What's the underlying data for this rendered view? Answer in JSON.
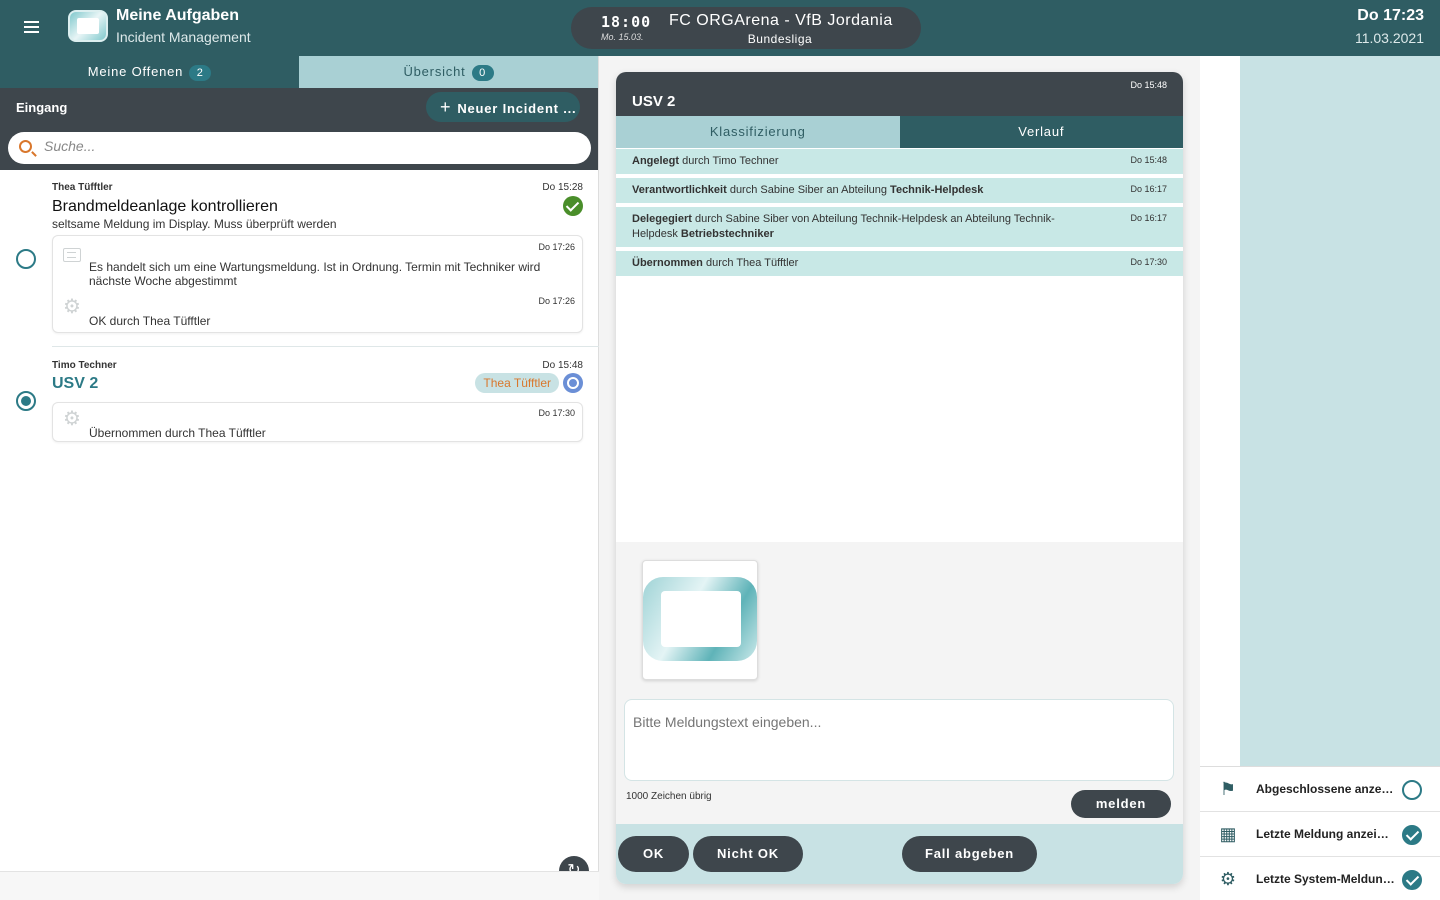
{
  "header": {
    "app_title": "Meine Aufgaben",
    "app_subtitle": "Incident Management",
    "match_time": "18:00",
    "match_date": "Mo. 15.03.",
    "match_teams": "FC ORGArena - VfB Jordania",
    "match_league": "Bundesliga",
    "clock_day": "Do 17:23",
    "clock_date": "11.03.2021"
  },
  "tabs": [
    {
      "label": "Meine Offenen",
      "count": "2"
    },
    {
      "label": "Übersicht",
      "count": "0"
    }
  ],
  "inbox": {
    "label": "Eingang",
    "new_button": "Neuer Incident ...",
    "search_placeholder": "Suche..."
  },
  "incidents": [
    {
      "author": "Thea Tüfftler",
      "time": "Do 15:28",
      "title": "Brandmeldeanlage kontrollieren",
      "description": "seltsame Meldung im Display. Muss überprüft werden",
      "entries": [
        {
          "icon": "message-icon",
          "time": "Do 17:26",
          "text": "Es handelt sich um eine Wartungsmeldung. Ist in Ordnung. Termin mit Techniker wird nächste Woche abgestimmt"
        },
        {
          "icon": "gear-icon",
          "time": "Do 17:26",
          "text": "OK durch Thea Tüfftler"
        }
      ]
    },
    {
      "author": "Timo Techner",
      "time": "Do 15:48",
      "title": "USV 2",
      "assignee": "Thea Tüfftler",
      "entries": [
        {
          "icon": "gear-icon",
          "time": "Do 17:30",
          "text": "Übernommen durch Thea Tüfftler"
        }
      ]
    }
  ],
  "detail": {
    "title": "USV 2",
    "time": "Do 15:48",
    "tabs": [
      "Klassifizierung",
      "Verlauf"
    ],
    "history": [
      {
        "action": "Angelegt",
        "rest": " durch Timo Techner",
        "time": "Do 15:48"
      },
      {
        "action": "Verantwortlichkeit",
        "rest": " durch Sabine Siber an Abteilung ",
        "target": "Technik-Helpdesk",
        "time": "Do 16:17"
      },
      {
        "action": "Delegegiert",
        "rest": " durch Sabine Siber von Abteilung Technik-Helpdesk an Abteilung Technik-Helpdesk ",
        "target": "Betriebstechniker",
        "time": "Do 16:17"
      },
      {
        "action": "Übernommen",
        "rest": " durch Thea Tüfftler",
        "time": "Do 17:30"
      }
    ],
    "message_placeholder": "Bitte Meldungstext eingeben...",
    "chars_left": "1000 Zeichen übrig",
    "send_button": "melden",
    "actions": [
      "OK",
      "Nicht OK",
      "Fall abgeben"
    ]
  },
  "options": [
    {
      "icon": "flags-icon",
      "label": "Abgeschlossene anzeig...",
      "checked": false
    },
    {
      "icon": "message-icon",
      "label": "Letzte Meldung anzeigen",
      "checked": true
    },
    {
      "icon": "gear-icon",
      "label": "Letzte System-Meldung...",
      "checked": true
    }
  ],
  "colors": {
    "header": "#2f5d63",
    "dark": "#3e464c",
    "accent": "#2c7a86",
    "light_teal": "#c8e2e4",
    "orange": "#d9772c",
    "success": "#4a8e2a"
  }
}
